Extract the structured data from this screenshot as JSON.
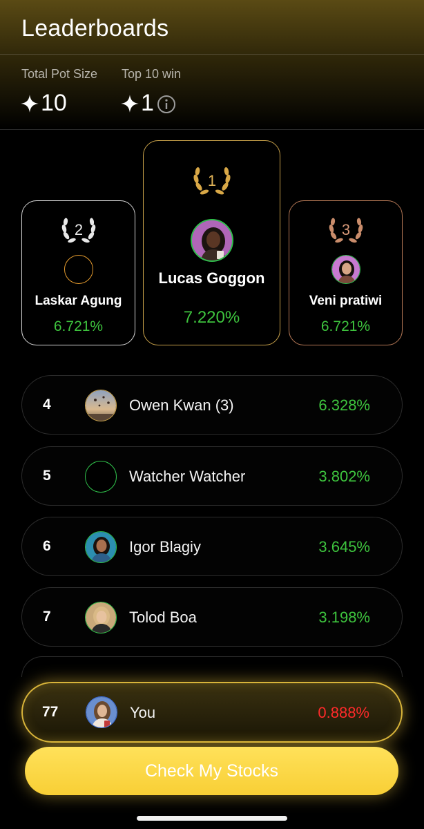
{
  "header": {
    "title": "Leaderboards",
    "stats": [
      {
        "label": "Total Pot Size",
        "value": "10",
        "icon": "sparkle-icon"
      },
      {
        "label": "Top 10 win",
        "value": "1",
        "icon": "sparkle-icon"
      }
    ],
    "info_icon": "info-icon"
  },
  "podium": [
    {
      "rank": "2",
      "name": "Laskar Agung",
      "pct": "6.721%",
      "color": "#d8d8d8"
    },
    {
      "rank": "1",
      "name": "Lucas Goggon",
      "pct": "7.220%",
      "color": "#c9a24a"
    },
    {
      "rank": "3",
      "name": "Veni pratiwi",
      "pct": "6.721%",
      "color": "#b87a57"
    }
  ],
  "rows": [
    {
      "rank": "4",
      "name": "Owen Kwan (3)",
      "pct": "6.328%"
    },
    {
      "rank": "5",
      "name": "Watcher Watcher",
      "pct": "3.802%"
    },
    {
      "rank": "6",
      "name": "Igor Blagiy",
      "pct": "3.645%"
    },
    {
      "rank": "7",
      "name": "Tolod Boa",
      "pct": "3.198%"
    }
  ],
  "you": {
    "rank": "77",
    "name": "You",
    "pct": "0.888%"
  },
  "cta": {
    "label": "Check My Stocks"
  },
  "colors": {
    "positive": "#3ec43e",
    "negative": "#ff2a2a",
    "accent": "#f8cf35"
  }
}
